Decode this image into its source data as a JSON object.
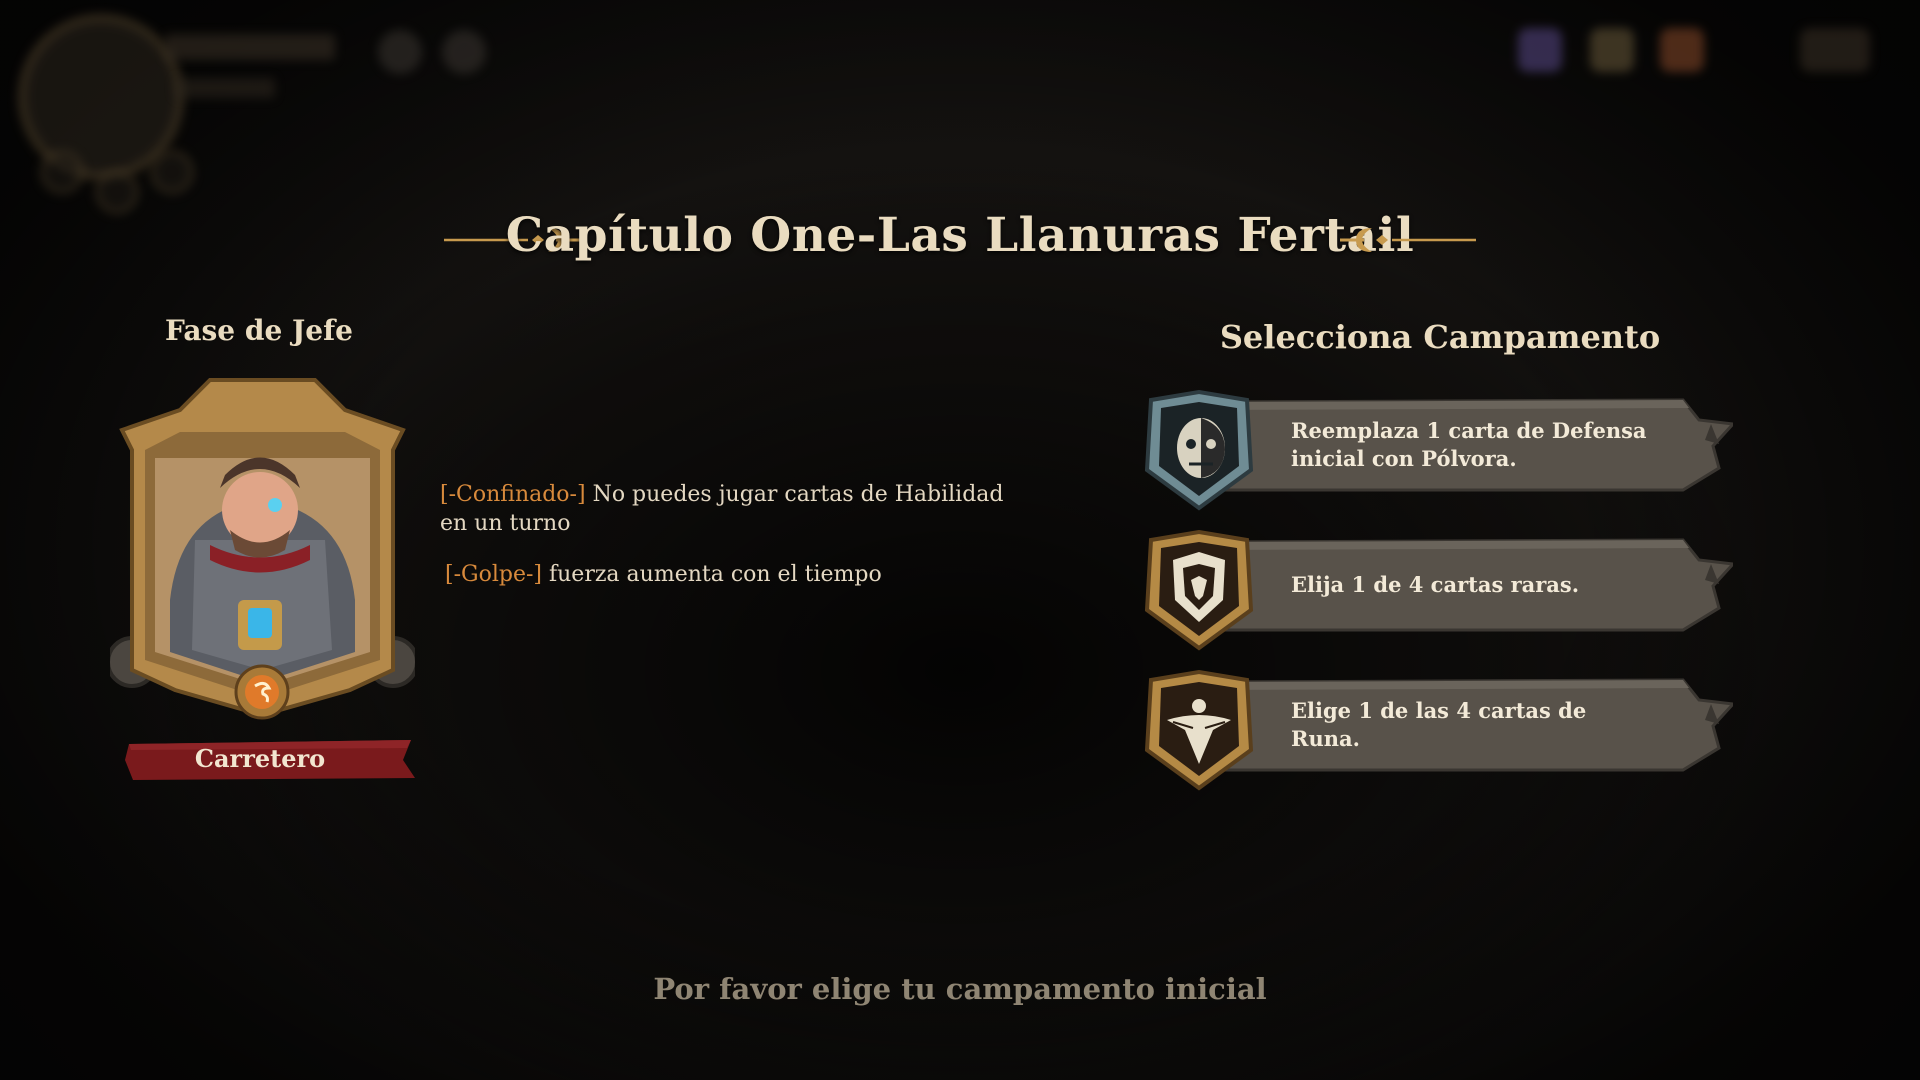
{
  "header": {
    "chapter_title": "Capítulo One-Las Llanuras Fertail"
  },
  "boss": {
    "heading": "Fase de Jefe",
    "name": "Carretero",
    "traits": [
      {
        "tag": "[-Confinado-]",
        "text": " No puedes jugar cartas de Habilidad en un turno"
      },
      {
        "tag": "[-Golpe-]",
        "text": " fuerza aumenta con el tiempo"
      }
    ]
  },
  "camps": {
    "heading": "Selecciona Campamento",
    "options": [
      {
        "text": "Reemplaza 1 carta de Defensa inicial con Pólvora.",
        "icon": "skull-face-icon",
        "frame_color": "#6f8c94"
      },
      {
        "text": "Elija 1 de 4 cartas raras.",
        "icon": "lion-crest-icon",
        "frame_color": "#b58a45"
      },
      {
        "text": "Elige 1 de las 4 cartas de Runa.",
        "icon": "winged-rune-icon",
        "frame_color": "#b58a45"
      }
    ]
  },
  "footer": {
    "hint": "Por favor elige tu campamento inicial"
  },
  "colors": {
    "accent_orange": "#d88a3c",
    "title_cream": "#eadcc0",
    "banner_stone": "#58524a",
    "boss_ribbon": "#7a1a1c"
  }
}
